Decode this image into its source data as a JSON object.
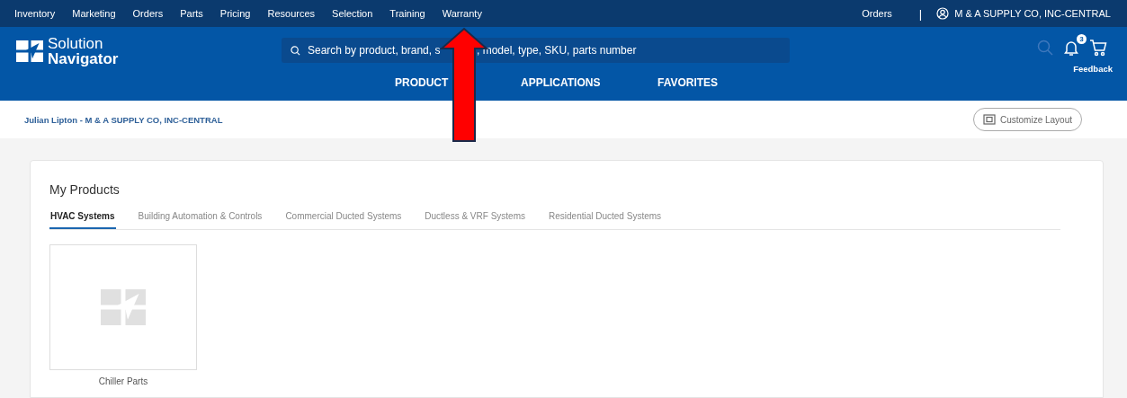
{
  "top_nav": {
    "items": [
      {
        "label": "Inventory"
      },
      {
        "label": "Marketing"
      },
      {
        "label": "Orders"
      },
      {
        "label": "Parts"
      },
      {
        "label": "Pricing"
      },
      {
        "label": "Resources"
      },
      {
        "label": "Selection"
      },
      {
        "label": "Training"
      },
      {
        "label": "Warranty"
      }
    ],
    "orders_link": "Orders",
    "separator": "|",
    "account": "M & A SUPPLY CO, INC-CENTRAL"
  },
  "header": {
    "logo_line_1": "Solution",
    "logo_line_2": "Navigator",
    "search": {
      "placeholder": "Search by product, brand, s",
      "placeholder_tail": ", model, type, SKU, parts number"
    },
    "notification_count": "3",
    "feedback": "Feedback",
    "nav": [
      {
        "label": "PRODUCT"
      },
      {
        "label": "APPLICATIONS"
      },
      {
        "label": "FAVORITES"
      }
    ]
  },
  "breadcrumb": "Julian Lipton - M & A SUPPLY CO, INC-CENTRAL",
  "customize_button": "Customize Layout",
  "my_products": {
    "title": "My Products",
    "tabs": [
      {
        "label": "HVAC Systems",
        "selected": true
      },
      {
        "label": "Building Automation & Controls",
        "selected": false
      },
      {
        "label": "Commercial Ducted Systems",
        "selected": false
      },
      {
        "label": "Ductless & VRF Systems",
        "selected": false
      },
      {
        "label": "Residential Ducted Systems",
        "selected": false
      }
    ],
    "tiles": [
      {
        "label": "Chiller Parts"
      }
    ]
  },
  "annotation": {
    "kind": "arrow"
  }
}
